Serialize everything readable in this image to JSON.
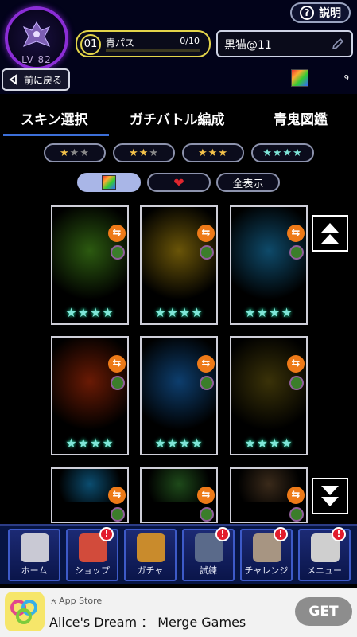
{
  "header": {
    "level_label": "LV 82",
    "help_label": "説明",
    "pass_number": "01",
    "pass_name": "青パス",
    "pass_progress_text": "0/10",
    "pass_progress_fraction": 0.0,
    "player_name": "黒猫@11",
    "back_label": "前に戻る",
    "item_count": "9"
  },
  "tabs": [
    {
      "label": "スキン選択",
      "active": true
    },
    {
      "label": "ガチバトル編成",
      "active": false
    },
    {
      "label": "青鬼図鑑",
      "active": false
    }
  ],
  "filters": {
    "rarity": [
      {
        "stars": "★★★",
        "gold": 1
      },
      {
        "stars": "★★★",
        "gold": 2
      },
      {
        "stars": "★★★",
        "gold": 3
      },
      {
        "stars": "★★★★",
        "gold": 0
      }
    ],
    "type_show_all_label": "全表示"
  },
  "cards": [
    {
      "name": "tank-skin",
      "stars": "★★★★",
      "theme": "#2c5a10"
    },
    {
      "name": "golden-beast-skin",
      "stars": "★★★★",
      "theme": "#6a5508"
    },
    {
      "name": "blue-turtle-skin",
      "stars": "★★★★",
      "theme": "#0e4a6a"
    },
    {
      "name": "fire-wolf-skin",
      "stars": "★★★★",
      "theme": "#6a1a04"
    },
    {
      "name": "ice-knight-skin",
      "stars": "★★★★",
      "theme": "#0d3e6e"
    },
    {
      "name": "dark-sage-skin",
      "stars": "★★★★",
      "theme": "#3a3208"
    },
    {
      "name": "ice-glasses-skin",
      "stars": "",
      "theme": "#0b4d70"
    },
    {
      "name": "green-dragon-skin",
      "stars": "",
      "theme": "#1e4a1a"
    },
    {
      "name": "girl-skin",
      "stars": "",
      "theme": "#3a2a1a"
    }
  ],
  "nav": [
    {
      "label": "ホーム",
      "alert": false,
      "color": "#c9c9d4"
    },
    {
      "label": "ショップ",
      "alert": true,
      "color": "#d24b3b"
    },
    {
      "label": "ガチャ",
      "alert": false,
      "color": "#c98b2c"
    },
    {
      "label": "試練",
      "alert": true,
      "color": "#5a6a8a"
    },
    {
      "label": "チャレンジ",
      "alert": true,
      "color": "#a79582"
    },
    {
      "label": "メニュー",
      "alert": true,
      "color": "#cfcfcf"
    }
  ],
  "ad": {
    "store": "App Store",
    "title": "Alice's Dream ： Merge Games",
    "cta": "GET"
  }
}
